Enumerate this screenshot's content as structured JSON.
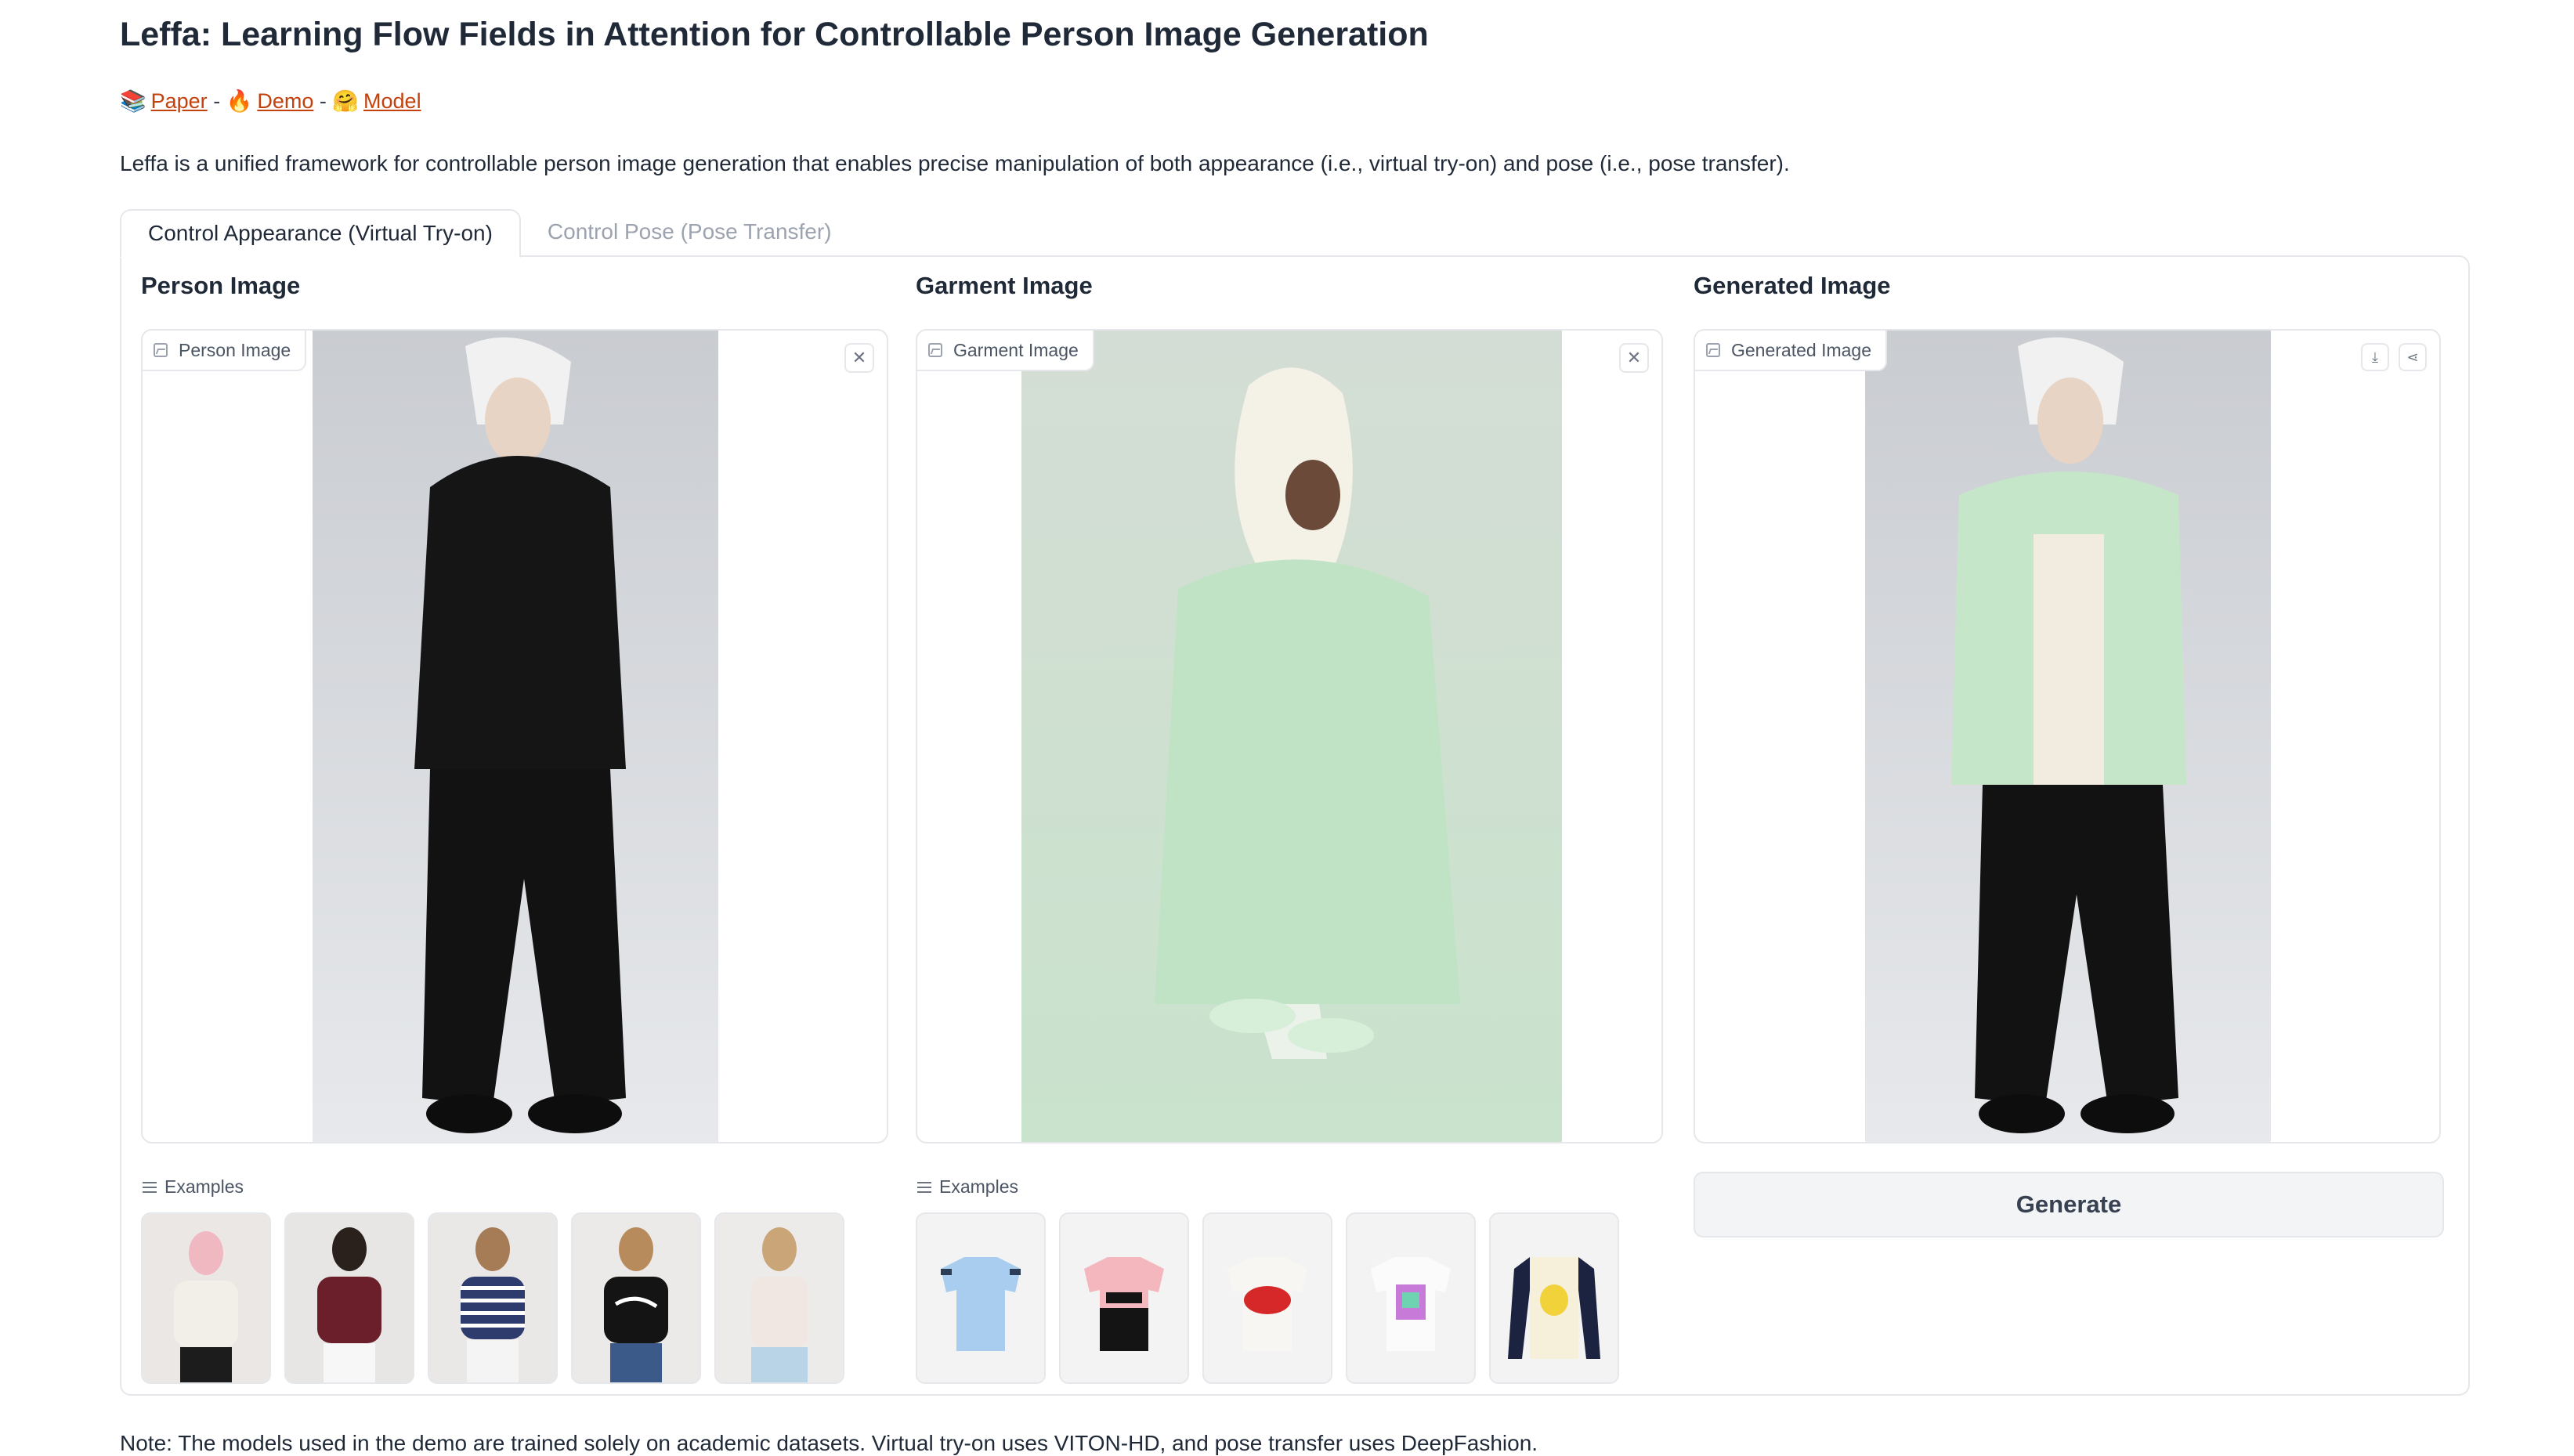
{
  "header": {
    "title": "Leffa: Learning Flow Fields in Attention for Controllable Person Image Generation",
    "links": [
      {
        "emoji": "📚",
        "label": "Paper"
      },
      {
        "emoji": "🔥",
        "label": "Demo"
      },
      {
        "emoji": "🤗",
        "label": "Model"
      }
    ],
    "separator": "-",
    "description": "Leffa is a unified framework for controllable person image generation that enables precise manipulation of both appearance (i.e., virtual try-on) and pose (i.e., pose transfer)."
  },
  "tabs": [
    {
      "label": "Control Appearance (Virtual Try-on)",
      "active": true
    },
    {
      "label": "Control Pose (Pose Transfer)",
      "active": false
    }
  ],
  "person": {
    "heading": "Person Image",
    "chip": "Person Image",
    "examples_label": "Examples",
    "icons": [
      "image-icon",
      "close-icon",
      "list-icon"
    ]
  },
  "garment": {
    "heading": "Garment Image",
    "chip": "Garment Image",
    "examples_label": "Examples",
    "icons": [
      "image-icon",
      "close-icon",
      "list-icon"
    ]
  },
  "generated": {
    "heading": "Generated Image",
    "chip": "Generated Image",
    "icons": [
      "image-icon",
      "download-icon",
      "share-icon"
    ]
  },
  "generate_button": "Generate",
  "note": "Note: The models used in the demo are trained solely on academic datasets. Virtual try-on uses VITON-HD, and pose transfer uses DeepFashion.",
  "colors": {
    "link": "#c2410c",
    "border": "#e5e7eb",
    "button_bg": "#f3f4f6",
    "muted_text": "#9ca3af"
  }
}
